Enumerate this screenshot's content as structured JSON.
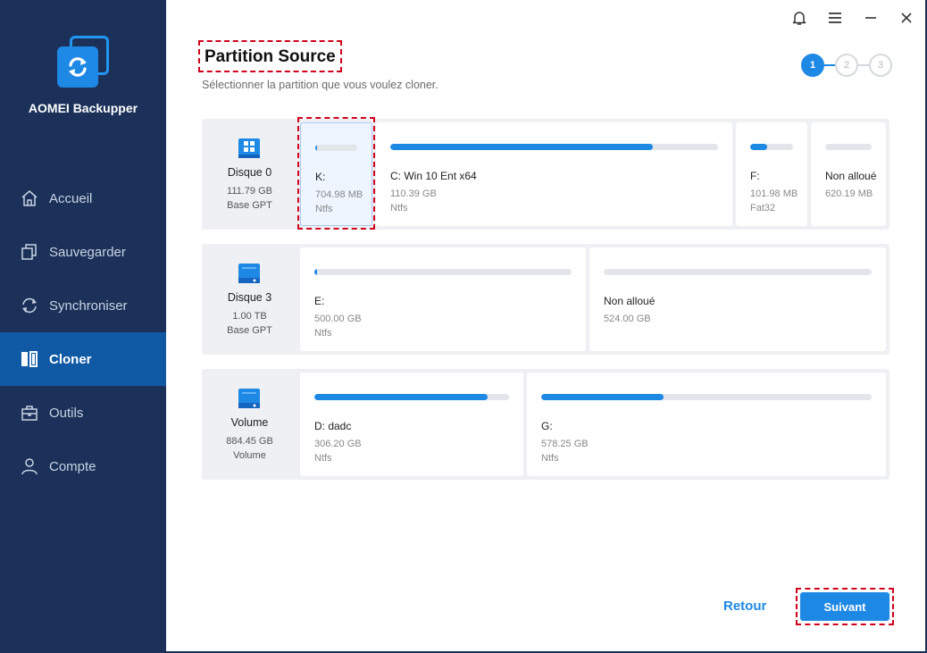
{
  "app": {
    "name": "AOMEI Backupper"
  },
  "nav": [
    {
      "label": "Accueil",
      "icon": "home-icon"
    },
    {
      "label": "Sauvegarder",
      "icon": "backup-icon"
    },
    {
      "label": "Synchroniser",
      "icon": "sync-icon"
    },
    {
      "label": "Cloner",
      "icon": "clone-icon",
      "active": true
    },
    {
      "label": "Outils",
      "icon": "tools-icon"
    },
    {
      "label": "Compte",
      "icon": "account-icon"
    }
  ],
  "header": {
    "title": "Partition Source",
    "subtitle": "Sélectionner la partition que vous voulez cloner."
  },
  "steps": [
    "1",
    "2",
    "3"
  ],
  "disks": [
    {
      "name": "Disque 0",
      "size": "111.79 GB",
      "type": "Base GPT",
      "partitions": [
        {
          "label": "K:",
          "size": "704.98 MB",
          "fs": "Ntfs",
          "used_fraction": 0.04,
          "selected": true
        },
        {
          "label": "C: Win 10 Ent x64",
          "size": "110.39 GB",
          "fs": "Ntfs",
          "used_fraction": 0.8
        },
        {
          "label": "F:",
          "size": "101.98 MB",
          "fs": "Fat32",
          "used_fraction": 0.4
        },
        {
          "label": "Non alloué",
          "size": "620.19 MB",
          "fs": "",
          "used_fraction": 0
        }
      ]
    },
    {
      "name": "Disque 3",
      "size": "1.00 TB",
      "type": "Base GPT",
      "partitions": [
        {
          "label": "E:",
          "size": "500.00 GB",
          "fs": "Ntfs",
          "used_fraction": 0.01
        },
        {
          "label": "Non alloué",
          "size": "524.00 GB",
          "fs": "",
          "used_fraction": 0
        }
      ]
    },
    {
      "name": "Volume",
      "size": "884.45 GB",
      "type": "Volume",
      "partitions": [
        {
          "label": "D: dadc",
          "size": "306.20 GB",
          "fs": "Ntfs",
          "used_fraction": 0.89
        },
        {
          "label": "G:",
          "size": "578.25 GB",
          "fs": "Ntfs",
          "used_fraction": 0.37
        }
      ]
    }
  ],
  "footer": {
    "back_label": "Retour",
    "next_label": "Suivant"
  },
  "colors": {
    "accent": "#1e88e5",
    "sidebar": "#1b3159",
    "highlight": "#d0021b"
  }
}
